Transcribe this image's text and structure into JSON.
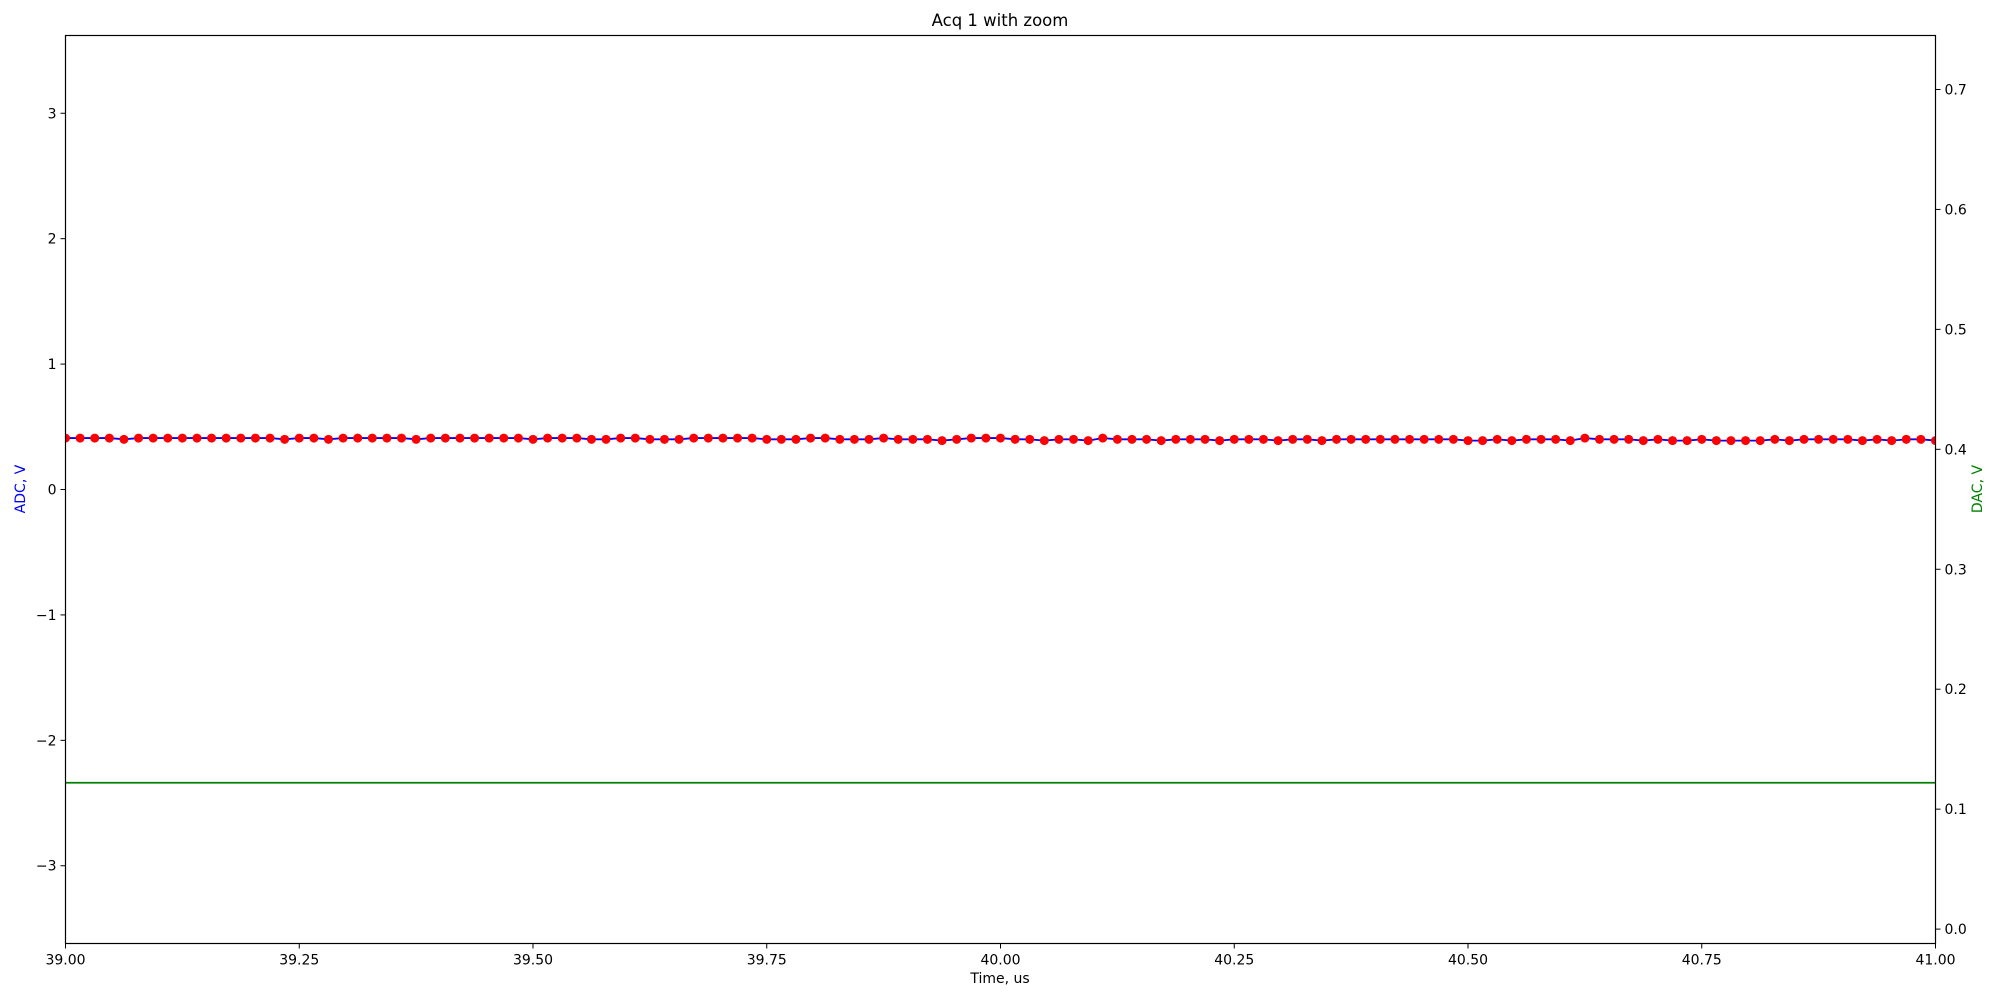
{
  "chart_data": {
    "type": "line",
    "title": "Acq 1 with zoom",
    "xlabel": "Time, us",
    "ylabel_left": "ADC, V",
    "ylabel_right": "DAC, V",
    "xlim": [
      39.0,
      41.0
    ],
    "ylim_left": [
      -3.62,
      3.62
    ],
    "ylim_right": [
      -0.012,
      0.745
    ],
    "x_ticks": [
      39.0,
      39.25,
      39.5,
      39.75,
      40.0,
      40.25,
      40.5,
      40.75,
      41.0
    ],
    "x_tick_labels": [
      "39.00",
      "39.25",
      "39.50",
      "39.75",
      "40.00",
      "40.25",
      "40.50",
      "40.75",
      "41.00"
    ],
    "y_left_ticks": [
      -3,
      -2,
      -1,
      0,
      1,
      2,
      3
    ],
    "y_left_tick_labels": [
      "−3",
      "−2",
      "−1",
      "0",
      "1",
      "2",
      "3"
    ],
    "y_right_ticks": [
      0.0,
      0.1,
      0.2,
      0.3,
      0.4,
      0.5,
      0.6,
      0.7
    ],
    "y_right_tick_labels": [
      "0.0",
      "0.1",
      "0.2",
      "0.3",
      "0.4",
      "0.5",
      "0.6",
      "0.7"
    ],
    "grid": false,
    "series": [
      {
        "axis": "left",
        "style": "line",
        "color": "#0000ff",
        "x_start": 39.0,
        "x_step": 0.015625,
        "values": [
          0.41,
          0.41,
          0.41,
          0.41,
          0.4,
          0.41,
          0.41,
          0.41,
          0.41,
          0.41,
          0.41,
          0.41,
          0.41,
          0.41,
          0.41,
          0.4,
          0.41,
          0.41,
          0.4,
          0.41,
          0.41,
          0.41,
          0.41,
          0.41,
          0.4,
          0.41,
          0.41,
          0.41,
          0.41,
          0.41,
          0.41,
          0.41,
          0.4,
          0.41,
          0.41,
          0.41,
          0.4,
          0.4,
          0.41,
          0.41,
          0.4,
          0.4,
          0.4,
          0.41,
          0.41,
          0.41,
          0.41,
          0.41,
          0.4,
          0.4,
          0.4,
          0.41,
          0.41,
          0.4,
          0.4,
          0.4,
          0.41,
          0.4,
          0.4,
          0.4,
          0.39,
          0.4,
          0.41,
          0.41,
          0.41,
          0.4,
          0.4,
          0.39,
          0.4,
          0.4,
          0.39,
          0.41,
          0.4,
          0.4,
          0.4,
          0.39,
          0.4,
          0.4,
          0.4,
          0.39,
          0.4,
          0.4,
          0.4,
          0.39,
          0.4,
          0.4,
          0.39,
          0.4,
          0.4,
          0.4,
          0.4,
          0.4,
          0.4,
          0.4,
          0.4,
          0.4,
          0.39,
          0.39,
          0.4,
          0.39,
          0.4,
          0.4,
          0.4,
          0.39,
          0.41,
          0.4,
          0.4,
          0.4,
          0.39,
          0.4,
          0.39,
          0.39,
          0.4,
          0.39,
          0.39,
          0.39,
          0.39,
          0.4,
          0.39,
          0.4,
          0.4,
          0.4,
          0.4,
          0.39,
          0.4,
          0.39,
          0.4,
          0.4,
          0.39
        ]
      },
      {
        "axis": "left",
        "style": "markers",
        "color": "#ff0000",
        "x_start": 39.0,
        "x_step": 0.015625,
        "values": [
          0.41,
          0.41,
          0.41,
          0.41,
          0.4,
          0.41,
          0.41,
          0.41,
          0.41,
          0.41,
          0.41,
          0.41,
          0.41,
          0.41,
          0.41,
          0.4,
          0.41,
          0.41,
          0.4,
          0.41,
          0.41,
          0.41,
          0.41,
          0.41,
          0.4,
          0.41,
          0.41,
          0.41,
          0.41,
          0.41,
          0.41,
          0.41,
          0.4,
          0.41,
          0.41,
          0.41,
          0.4,
          0.4,
          0.41,
          0.41,
          0.4,
          0.4,
          0.4,
          0.41,
          0.41,
          0.41,
          0.41,
          0.41,
          0.4,
          0.4,
          0.4,
          0.41,
          0.41,
          0.4,
          0.4,
          0.4,
          0.41,
          0.4,
          0.4,
          0.4,
          0.39,
          0.4,
          0.41,
          0.41,
          0.41,
          0.4,
          0.4,
          0.39,
          0.4,
          0.4,
          0.39,
          0.41,
          0.4,
          0.4,
          0.4,
          0.39,
          0.4,
          0.4,
          0.4,
          0.39,
          0.4,
          0.4,
          0.4,
          0.39,
          0.4,
          0.4,
          0.39,
          0.4,
          0.4,
          0.4,
          0.4,
          0.4,
          0.4,
          0.4,
          0.4,
          0.4,
          0.39,
          0.39,
          0.4,
          0.39,
          0.4,
          0.4,
          0.4,
          0.39,
          0.41,
          0.4,
          0.4,
          0.4,
          0.39,
          0.4,
          0.39,
          0.39,
          0.4,
          0.39,
          0.39,
          0.39,
          0.39,
          0.4,
          0.39,
          0.4,
          0.4,
          0.4,
          0.4,
          0.39,
          0.4,
          0.39,
          0.4,
          0.4,
          0.39
        ]
      },
      {
        "axis": "right",
        "style": "line",
        "color": "#008000",
        "x": [
          39.0,
          41.0
        ],
        "values": [
          0.122,
          0.122
        ]
      }
    ],
    "colors": {
      "left_label": "#0000ff",
      "right_label": "#008000"
    }
  }
}
